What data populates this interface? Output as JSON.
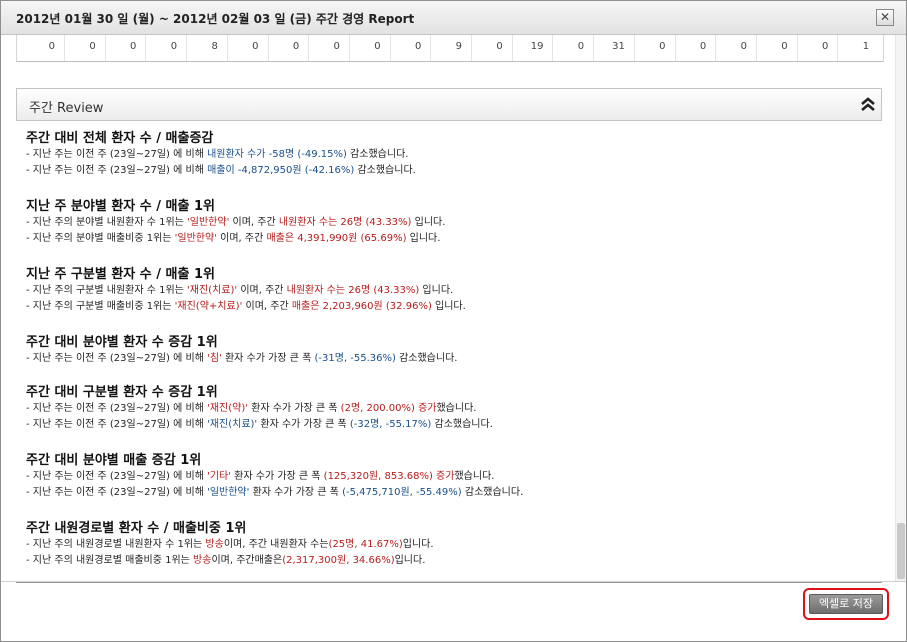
{
  "window": {
    "title": "2012년 01월 30 일 (월) ~ 2012년 02월 03 일 (금) 주간 경영 Report",
    "close_glyph": "✕"
  },
  "table_row": {
    "values": [
      "0",
      "0",
      "0",
      "0",
      "8",
      "0",
      "0",
      "0",
      "0",
      "0",
      "9",
      "0",
      "19",
      "0",
      "31",
      "0",
      "0",
      "0",
      "0",
      "0",
      "1"
    ]
  },
  "section": {
    "title": "주간 Review"
  },
  "review": [
    {
      "heading": "주간 대비 전체 환자 수 / 매출증감",
      "lines": [
        [
          {
            "t": "- 지난 주는 이전 주 (23일~27일) 에 비해 ",
            "c": ""
          },
          {
            "t": "내원환자 수가 -58명 (-49.15%)",
            "c": "blue"
          },
          {
            "t": " 감소했습니다.",
            "c": ""
          }
        ],
        [
          {
            "t": "- 지난 주는 이전 주 (23일~27일) 에 비해 ",
            "c": ""
          },
          {
            "t": "매출이 -4,872,950원 (-42.16%)",
            "c": "blue"
          },
          {
            "t": " 감소했습니다.",
            "c": ""
          }
        ]
      ]
    },
    {
      "heading": "지난 주 분야별 환자 수 / 매출 1위",
      "lines": [
        [
          {
            "t": "- 지난 주의 분야별 내원환자 수 1위는 ",
            "c": ""
          },
          {
            "t": "'일반한약'",
            "c": "red"
          },
          {
            "t": " 이며, 주간 ",
            "c": ""
          },
          {
            "t": "내원환자 수는 26명 (43.33%)",
            "c": "red"
          },
          {
            "t": " 입니다.",
            "c": ""
          }
        ],
        [
          {
            "t": "- 지난 주의 분야별 매출비중 1위는 ",
            "c": ""
          },
          {
            "t": "'일반한약'",
            "c": "red"
          },
          {
            "t": " 이며, 주간 ",
            "c": ""
          },
          {
            "t": "매출은 4,391,990원 (65.69%)",
            "c": "red"
          },
          {
            "t": " 입니다.",
            "c": ""
          }
        ]
      ]
    },
    {
      "heading": "지난 주 구분별 환자 수 / 매출 1위",
      "lines": [
        [
          {
            "t": "- 지난 주의 구분별 내원환자 수 1위는 ",
            "c": ""
          },
          {
            "t": "'재진(치료)'",
            "c": "red"
          },
          {
            "t": " 이며, 주간 ",
            "c": ""
          },
          {
            "t": "내원환자 수는 26명 (43.33%)",
            "c": "red"
          },
          {
            "t": " 입니다.",
            "c": ""
          }
        ],
        [
          {
            "t": "- 지난 주의 구분별 매출비중 1위는 ",
            "c": ""
          },
          {
            "t": "'재진(약+치료)'",
            "c": "red"
          },
          {
            "t": " 이며, 주간 ",
            "c": ""
          },
          {
            "t": "매출은 2,203,960원 (32.96%)",
            "c": "red"
          },
          {
            "t": " 입니다.",
            "c": ""
          }
        ]
      ]
    },
    {
      "heading": "주간 대비 분야별 환자 수 증감 1위",
      "lines": [
        [
          {
            "t": "- 지난 주는 이전 주 (23일~27일) 에 비해 ",
            "c": ""
          },
          {
            "t": "'침'",
            "c": "red"
          },
          {
            "t": " 환자 수가 가장 큰 폭 ",
            "c": ""
          },
          {
            "t": "(-31명, -55.36%)",
            "c": "blue"
          },
          {
            "t": " 감소했습니다.",
            "c": ""
          }
        ]
      ]
    },
    {
      "heading": "주간 대비 구분별 환자 수 증감 1위",
      "lines": [
        [
          {
            "t": "- 지난 주는 이전 주 (23일~27일) 에 비해 ",
            "c": ""
          },
          {
            "t": "'재진(약)'",
            "c": "red"
          },
          {
            "t": " 환자 수가 가장 큰 폭 ",
            "c": ""
          },
          {
            "t": "(2명, 200.00%) 증가",
            "c": "red"
          },
          {
            "t": "했습니다.",
            "c": ""
          }
        ],
        [
          {
            "t": "- 지난 주는 이전 주 (23일~27일) 에 비해 ",
            "c": ""
          },
          {
            "t": "'재진(치료)'",
            "c": "blue"
          },
          {
            "t": " 환자 수가 가장 큰 폭 ",
            "c": ""
          },
          {
            "t": "(-32명, -55.17%)",
            "c": "blue"
          },
          {
            "t": " 감소했습니다.",
            "c": ""
          }
        ]
      ]
    },
    {
      "heading": "주간 대비 분야별 매출 증감 1위",
      "lines": [
        [
          {
            "t": "- 지난 주는 이전 주 (23일~27일) 에 비해 ",
            "c": ""
          },
          {
            "t": "'기타'",
            "c": "red"
          },
          {
            "t": " 환자 수가 가장 큰 폭 ",
            "c": ""
          },
          {
            "t": "(125,320원, 853.68%) 증가",
            "c": "red"
          },
          {
            "t": "했습니다.",
            "c": ""
          }
        ],
        [
          {
            "t": "- 지난 주는 이전 주 (23일~27일) 에 비해 ",
            "c": ""
          },
          {
            "t": "'일반한약'",
            "c": "blue"
          },
          {
            "t": " 환자 수가 가장 큰 폭 ",
            "c": ""
          },
          {
            "t": "(-5,475,710원, -55.49%)",
            "c": "blue"
          },
          {
            "t": " 감소했습니다.",
            "c": ""
          }
        ]
      ]
    },
    {
      "heading": "주간 내원경로별 환자 수 / 매출비중 1위",
      "lines": [
        [
          {
            "t": "- 지난 주의 내원경로별 내원환자 수 1위는 ",
            "c": ""
          },
          {
            "t": "방송",
            "c": "red"
          },
          {
            "t": "이며, 주간 내원환자 수는",
            "c": ""
          },
          {
            "t": "(25명, 41.67%)",
            "c": "red"
          },
          {
            "t": "입니다.",
            "c": ""
          }
        ],
        [
          {
            "t": "- 지난 주의 내원경로별 매출비중 1위는 ",
            "c": ""
          },
          {
            "t": "방송",
            "c": "red"
          },
          {
            "t": "이며, 주간매출은",
            "c": ""
          },
          {
            "t": "(2,317,300원, 34.66%)",
            "c": "red"
          },
          {
            "t": "입니다.",
            "c": ""
          }
        ]
      ]
    }
  ],
  "footer": {
    "excel_button_label": "엑셀로 저장"
  },
  "colors": {
    "highlight": "#e0101a",
    "increase": "#b71c1c",
    "decrease": "#1a4f8a"
  }
}
